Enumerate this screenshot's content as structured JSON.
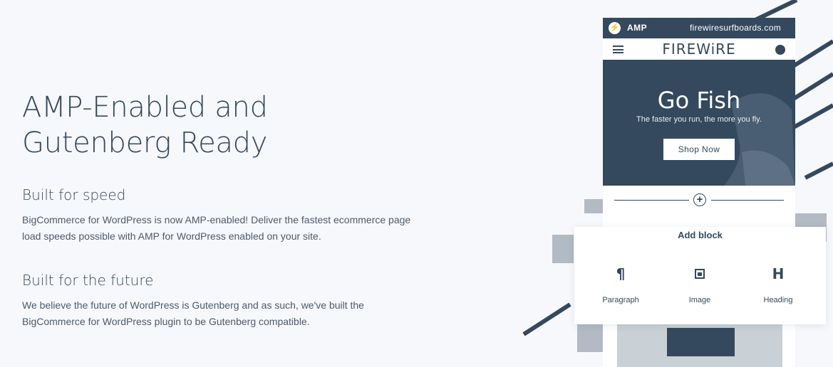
{
  "section": {
    "headline_line1": "AMP-Enabled and",
    "headline_line2": "Gutenberg Ready",
    "features": [
      {
        "title": "Built for speed",
        "body_line1": "BigCommerce for WordPress is now AMP-enabled! Deliver the fastest ecommerce page",
        "body_line2": "load speeds possible with AMP for WordPress enabled on your site."
      },
      {
        "title": "Built for the future",
        "body_line1": "We believe the future of WordPress is Gutenberg and as such, we've built the",
        "body_line2": "BigCommerce for WordPress plugin to be Gutenberg compatible."
      }
    ]
  },
  "phone_mockup": {
    "amp_bar": {
      "logo_icon": "lightning-icon",
      "logo_glyph": "⚡",
      "label": "AMP",
      "domain": "firewiresurfboards.com"
    },
    "nav": {
      "menu_icon": "hamburger-icon",
      "brand": "FIREWiRE",
      "cart_icon": "cart-icon"
    },
    "hero": {
      "title": "Go Fish",
      "subtitle": "The faster you run, the more you fly.",
      "button": "Shop Now"
    },
    "inserter": {
      "icon": "plus-circle-icon",
      "glyph": "+"
    }
  },
  "add_block_panel": {
    "title": "Add block",
    "blocks": [
      {
        "label": "Paragraph",
        "icon": "paragraph-icon",
        "glyph": "¶"
      },
      {
        "label": "Image",
        "icon": "image-icon",
        "glyph": ""
      },
      {
        "label": "Heading",
        "icon": "heading-icon",
        "glyph": "H"
      }
    ]
  },
  "colors": {
    "primary": "#34495e",
    "background": "#f7f8fb",
    "panel": "#ffffff"
  }
}
